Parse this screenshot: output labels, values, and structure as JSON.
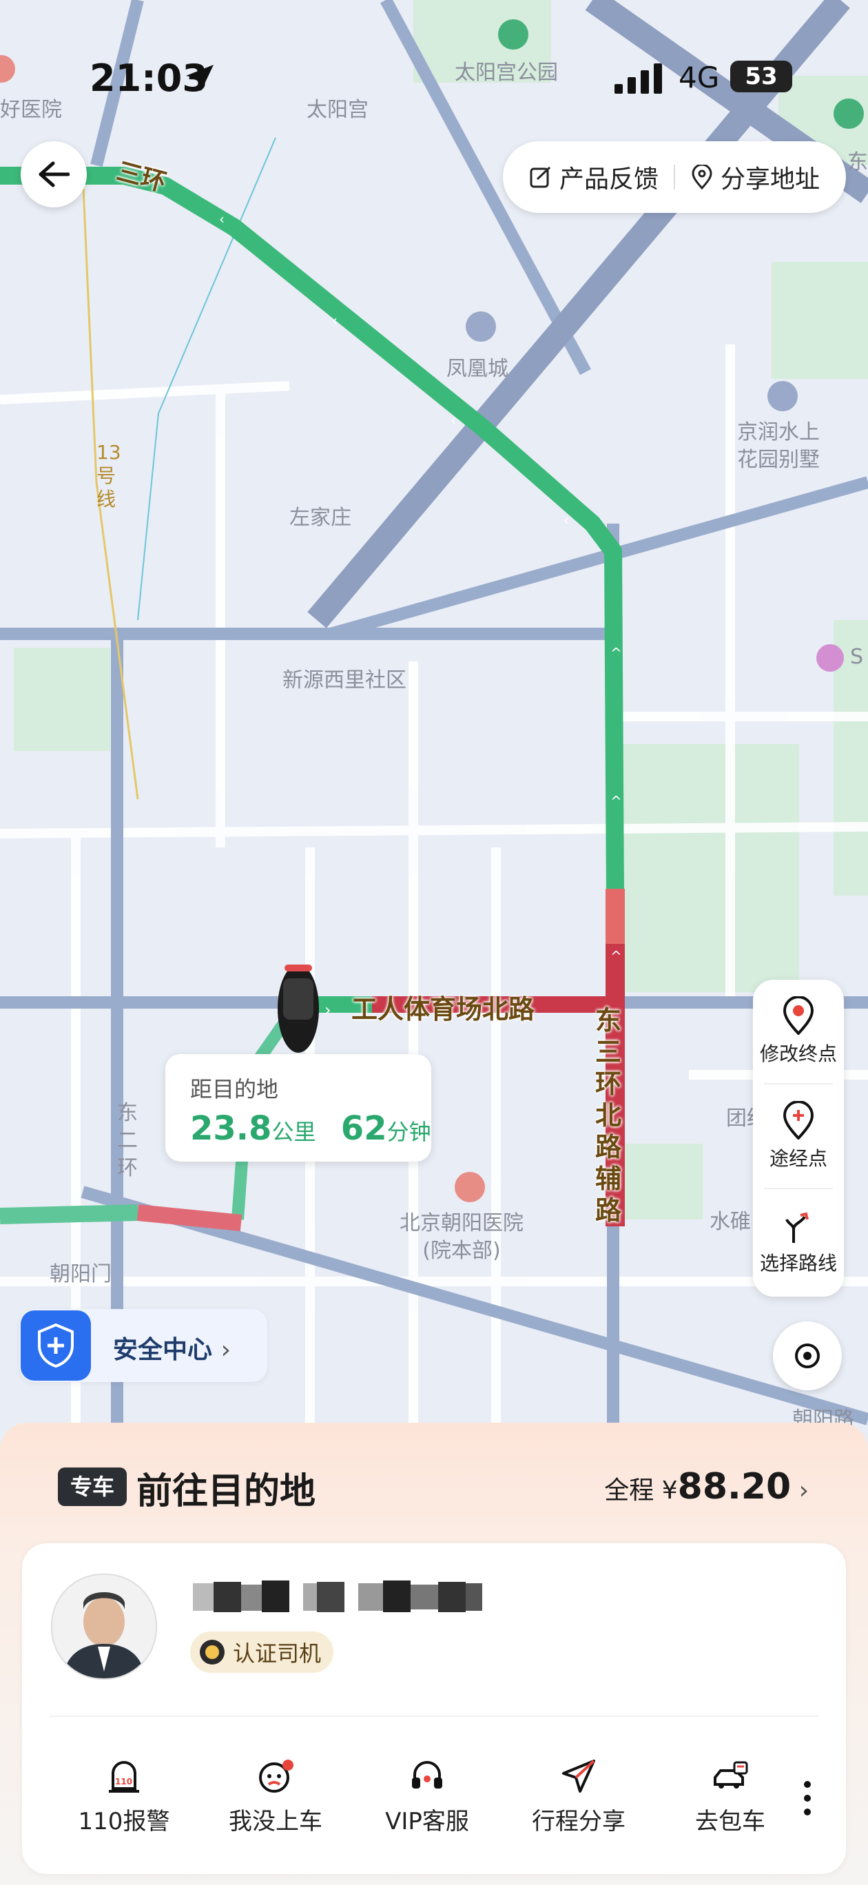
{
  "status_bar": {
    "time": "21:03",
    "network": "4G",
    "battery": "53"
  },
  "map": {
    "labels": {
      "taiyanggong_park": "太阳宫公园",
      "taiyanggong": "太阳宫",
      "hospital_partial": "好医院",
      "fenghuangcheng": "凤凰城",
      "jingrun": "京润水上\n花园别墅",
      "zuojiazhuang": "左家庄",
      "xinyuan": "新源西里社区",
      "line13": "13号线",
      "chaoyang_hospital": "北京朝阳医院\n(院本部)",
      "chaoyangmen": "朝阳门",
      "east2ring": "东二环",
      "shuidui": "水碓",
      "tuan": "团结",
      "chaoyang_road": "朝阳路",
      "east4_partial": "东四",
      "s_partial": "S"
    },
    "road_labels": {
      "third_ring": "三环",
      "gongti_north": "工人体育场北路",
      "east3_aux": "东三环北路辅路"
    }
  },
  "back_button": {
    "icon": "arrow-left-icon"
  },
  "top_actions": {
    "feedback": "产品反馈",
    "share_address": "分享地址"
  },
  "right_tools": {
    "edit_destination": "修改终点",
    "waypoint": "途经点",
    "choose_route": "选择路线"
  },
  "distance_card": {
    "label": "距目的地",
    "distance_value": "23.8",
    "distance_unit": "公里",
    "time_value": "62",
    "time_unit": "分钟"
  },
  "safety_center": {
    "label": "安全中心",
    "chevron": "›"
  },
  "trip": {
    "badge": "专车",
    "title": "前往目的地",
    "fare_prefix": "全程 ¥",
    "fare_amount": "88.20",
    "fare_chevron": "›"
  },
  "driver": {
    "certified_label": "认证司机"
  },
  "actions": [
    {
      "label": "110报警",
      "icon": "alarm-icon"
    },
    {
      "label": "我没上车",
      "icon": "not-boarded-icon"
    },
    {
      "label": "VIP客服",
      "icon": "headset-icon"
    },
    {
      "label": "行程分享",
      "icon": "share-arrow-icon"
    },
    {
      "label": "去包车",
      "icon": "charter-car-icon"
    }
  ],
  "colors": {
    "route_green": "#3bb97a",
    "route_red": "#c9394a",
    "accent_green": "#2aa86e",
    "safety_blue": "#2a6ff0"
  }
}
